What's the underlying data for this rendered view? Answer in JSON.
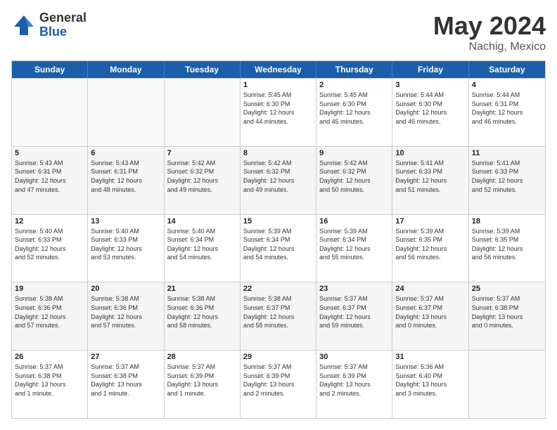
{
  "logo": {
    "general": "General",
    "blue": "Blue"
  },
  "title": {
    "month_year": "May 2024",
    "location": "Nachig, Mexico"
  },
  "weekdays": [
    "Sunday",
    "Monday",
    "Tuesday",
    "Wednesday",
    "Thursday",
    "Friday",
    "Saturday"
  ],
  "rows": [
    [
      {
        "day": "",
        "info": ""
      },
      {
        "day": "",
        "info": ""
      },
      {
        "day": "",
        "info": ""
      },
      {
        "day": "1",
        "info": "Sunrise: 5:45 AM\nSunset: 6:30 PM\nDaylight: 12 hours\nand 44 minutes."
      },
      {
        "day": "2",
        "info": "Sunrise: 5:45 AM\nSunset: 6:30 PM\nDaylight: 12 hours\nand 45 minutes."
      },
      {
        "day": "3",
        "info": "Sunrise: 5:44 AM\nSunset: 6:30 PM\nDaylight: 12 hours\nand 46 minutes."
      },
      {
        "day": "4",
        "info": "Sunrise: 5:44 AM\nSunset: 6:31 PM\nDaylight: 12 hours\nand 46 minutes."
      }
    ],
    [
      {
        "day": "5",
        "info": "Sunrise: 5:43 AM\nSunset: 6:31 PM\nDaylight: 12 hours\nand 47 minutes."
      },
      {
        "day": "6",
        "info": "Sunrise: 5:43 AM\nSunset: 6:31 PM\nDaylight: 12 hours\nand 48 minutes."
      },
      {
        "day": "7",
        "info": "Sunrise: 5:42 AM\nSunset: 6:32 PM\nDaylight: 12 hours\nand 49 minutes."
      },
      {
        "day": "8",
        "info": "Sunrise: 5:42 AM\nSunset: 6:32 PM\nDaylight: 12 hours\nand 49 minutes."
      },
      {
        "day": "9",
        "info": "Sunrise: 5:42 AM\nSunset: 6:32 PM\nDaylight: 12 hours\nand 50 minutes."
      },
      {
        "day": "10",
        "info": "Sunrise: 5:41 AM\nSunset: 6:33 PM\nDaylight: 12 hours\nand 51 minutes."
      },
      {
        "day": "11",
        "info": "Sunrise: 5:41 AM\nSunset: 6:33 PM\nDaylight: 12 hours\nand 52 minutes."
      }
    ],
    [
      {
        "day": "12",
        "info": "Sunrise: 5:40 AM\nSunset: 6:33 PM\nDaylight: 12 hours\nand 52 minutes."
      },
      {
        "day": "13",
        "info": "Sunrise: 5:40 AM\nSunset: 6:33 PM\nDaylight: 12 hours\nand 53 minutes."
      },
      {
        "day": "14",
        "info": "Sunrise: 5:40 AM\nSunset: 6:34 PM\nDaylight: 12 hours\nand 54 minutes."
      },
      {
        "day": "15",
        "info": "Sunrise: 5:39 AM\nSunset: 6:34 PM\nDaylight: 12 hours\nand 54 minutes."
      },
      {
        "day": "16",
        "info": "Sunrise: 5:39 AM\nSunset: 6:34 PM\nDaylight: 12 hours\nand 55 minutes."
      },
      {
        "day": "17",
        "info": "Sunrise: 5:39 AM\nSunset: 6:35 PM\nDaylight: 12 hours\nand 56 minutes."
      },
      {
        "day": "18",
        "info": "Sunrise: 5:39 AM\nSunset: 6:35 PM\nDaylight: 12 hours\nand 56 minutes."
      }
    ],
    [
      {
        "day": "19",
        "info": "Sunrise: 5:38 AM\nSunset: 6:36 PM\nDaylight: 12 hours\nand 57 minutes."
      },
      {
        "day": "20",
        "info": "Sunrise: 5:38 AM\nSunset: 6:36 PM\nDaylight: 12 hours\nand 57 minutes."
      },
      {
        "day": "21",
        "info": "Sunrise: 5:38 AM\nSunset: 6:36 PM\nDaylight: 12 hours\nand 58 minutes."
      },
      {
        "day": "22",
        "info": "Sunrise: 5:38 AM\nSunset: 6:37 PM\nDaylight: 12 hours\nand 58 minutes."
      },
      {
        "day": "23",
        "info": "Sunrise: 5:37 AM\nSunset: 6:37 PM\nDaylight: 12 hours\nand 59 minutes."
      },
      {
        "day": "24",
        "info": "Sunrise: 5:37 AM\nSunset: 6:37 PM\nDaylight: 13 hours\nand 0 minutes."
      },
      {
        "day": "25",
        "info": "Sunrise: 5:37 AM\nSunset: 6:38 PM\nDaylight: 13 hours\nand 0 minutes."
      }
    ],
    [
      {
        "day": "26",
        "info": "Sunrise: 5:37 AM\nSunset: 6:38 PM\nDaylight: 13 hours\nand 1 minute."
      },
      {
        "day": "27",
        "info": "Sunrise: 5:37 AM\nSunset: 6:38 PM\nDaylight: 13 hours\nand 1 minute."
      },
      {
        "day": "28",
        "info": "Sunrise: 5:37 AM\nSunset: 6:39 PM\nDaylight: 13 hours\nand 1 minute."
      },
      {
        "day": "29",
        "info": "Sunrise: 5:37 AM\nSunset: 6:39 PM\nDaylight: 13 hours\nand 2 minutes."
      },
      {
        "day": "30",
        "info": "Sunrise: 5:37 AM\nSunset: 6:39 PM\nDaylight: 13 hours\nand 2 minutes."
      },
      {
        "day": "31",
        "info": "Sunrise: 5:36 AM\nSunset: 6:40 PM\nDaylight: 13 hours\nand 3 minutes."
      },
      {
        "day": "",
        "info": ""
      }
    ]
  ]
}
